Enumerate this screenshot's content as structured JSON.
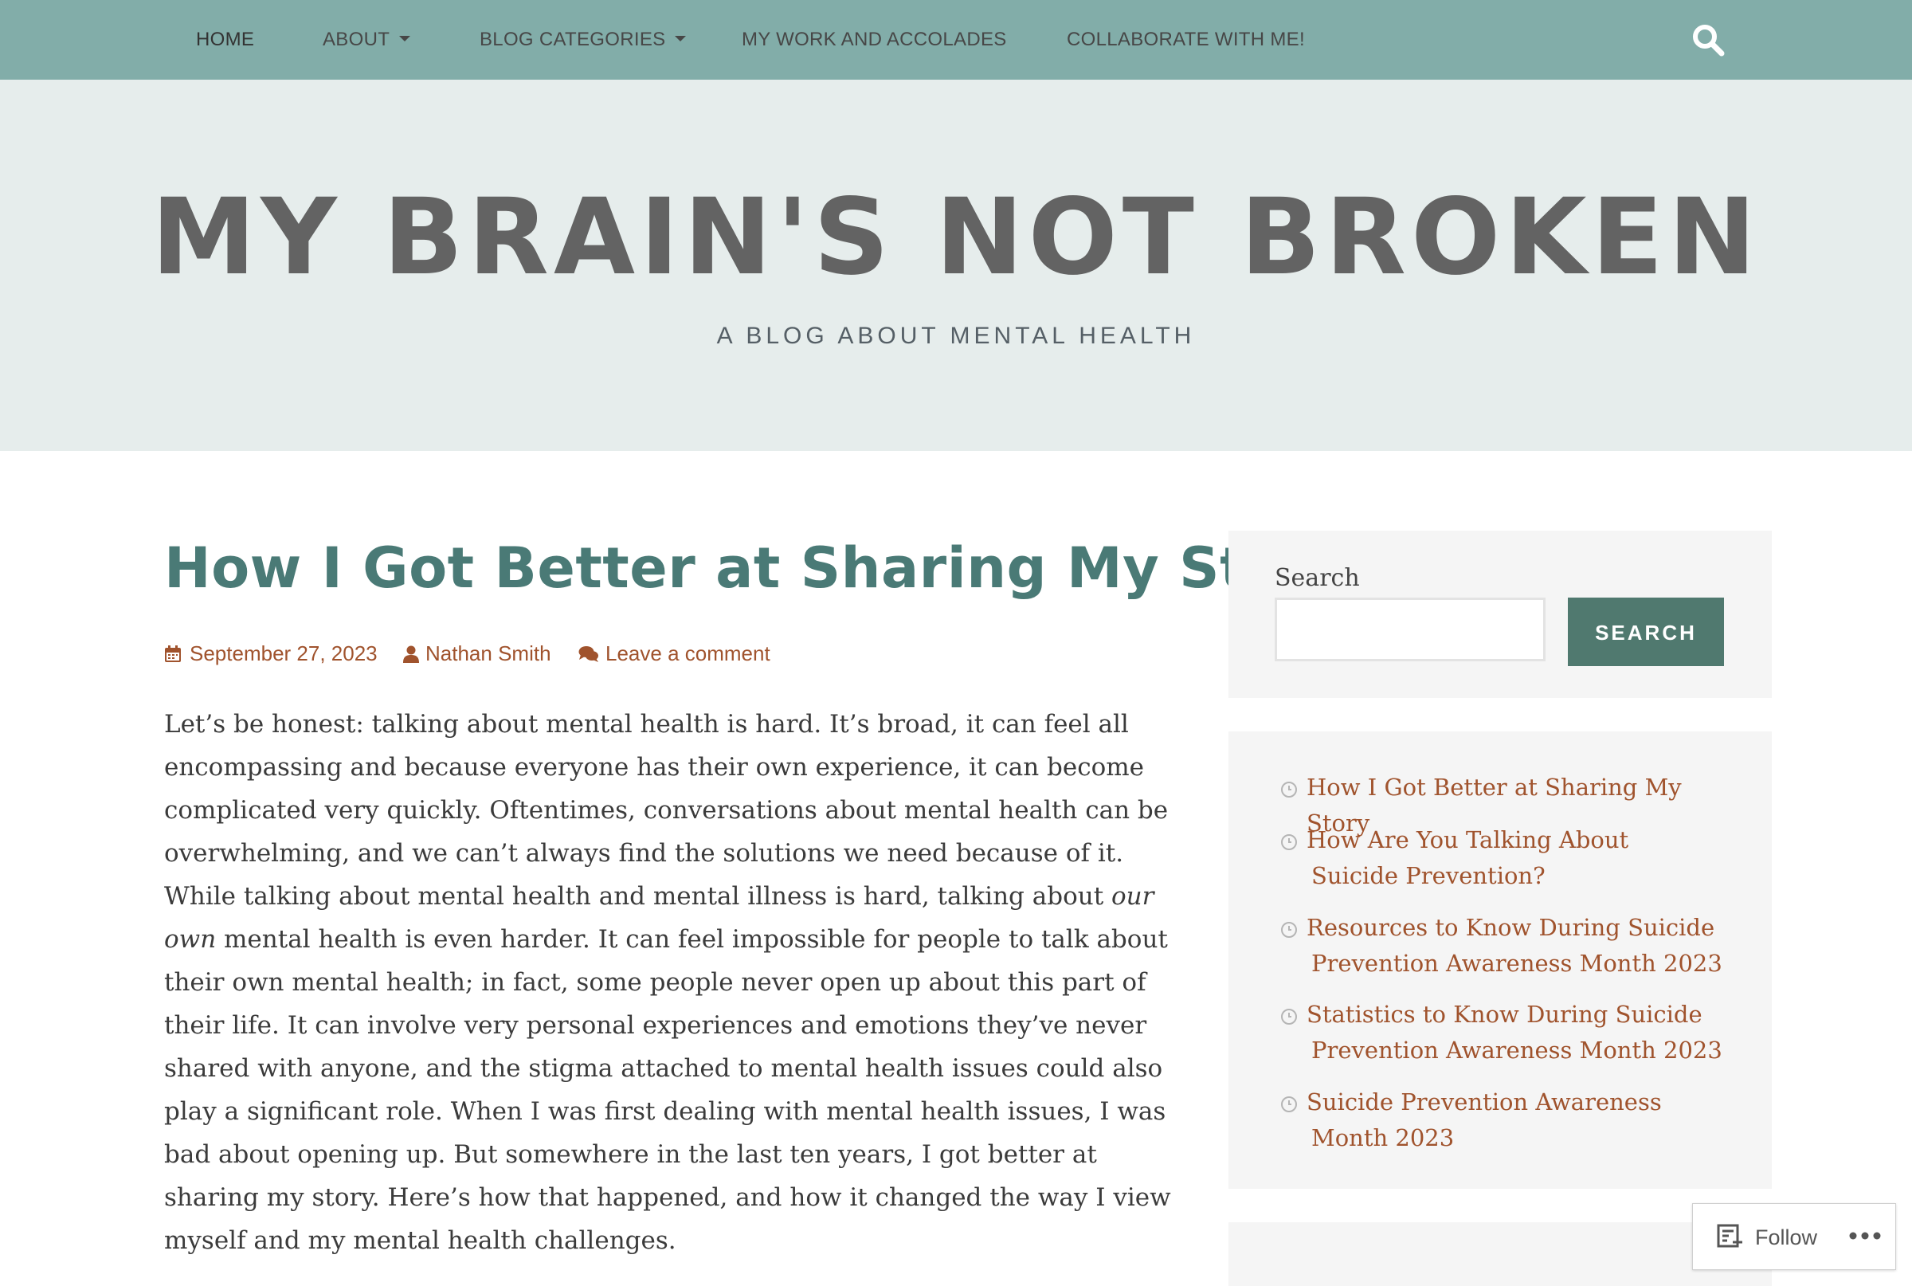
{
  "nav": {
    "items": [
      {
        "label": "HOME"
      },
      {
        "label": "ABOUT"
      },
      {
        "label": "BLOG CATEGORIES"
      },
      {
        "label": "MY WORK AND ACCOLADES"
      },
      {
        "label": "COLLABORATE WITH ME!"
      }
    ],
    "search_icon": "search-icon"
  },
  "header": {
    "title": "MY BRAIN'S NOT BROKEN",
    "description": "A BLOG ABOUT MENTAL HEALTH"
  },
  "post": {
    "title": "How I Got Better at Sharing My Story",
    "date": "September 27, 2023",
    "author": "Nathan Smith",
    "comments": "Leave a comment",
    "body_before": "Let’s be honest: talking about mental health is hard. It’s broad, it can feel all encompassing and because everyone has their own experience, it can become complicated very quickly. Oftentimes, conversations about mental health can be overwhelming, and we can’t always find the solutions we need because of it. While talking about mental health and mental illness is hard, talking about ",
    "body_emphasis": "our own",
    "body_after": " mental health is even harder. It can feel impossible for people to talk about their own mental health; in fact, some people never open up about this part of their life. It can involve very personal experiences and emotions they’ve never shared with anyone, and the stigma attached to mental health issues could also play a significant role. When I was first dealing with mental health issues, I was bad about opening up. But somewhere in the last ten years, I got better at sharing my story. Here’s how that happened, and how it changed the way I view myself and my mental health challenges."
  },
  "sidebar": {
    "search_label": "Search",
    "search_input_value": "",
    "search_button": "SEARCH",
    "recent_posts": [
      {
        "line1": "How I Got Better at Sharing My Story",
        "line2": ""
      },
      {
        "line1": "How Are You Talking About",
        "line2": "Suicide Prevention?"
      },
      {
        "line1": "Resources to Know During Suicide",
        "line2": "Prevention Awareness Month 2023"
      },
      {
        "line1": "Statistics to Know During Suicide",
        "line2": "Prevention Awareness Month 2023"
      },
      {
        "line1": "Suicide Prevention Awareness",
        "line2": "Month 2023"
      }
    ]
  },
  "follow": {
    "label": "Follow",
    "more_icon": "more-horizontal-icon"
  },
  "colors": {
    "nav_bg": "#82ada9",
    "header_bg": "#e6edec",
    "title": "#636363",
    "post_title": "#4a7a76",
    "link": "#a0532d",
    "button": "#50796f"
  }
}
